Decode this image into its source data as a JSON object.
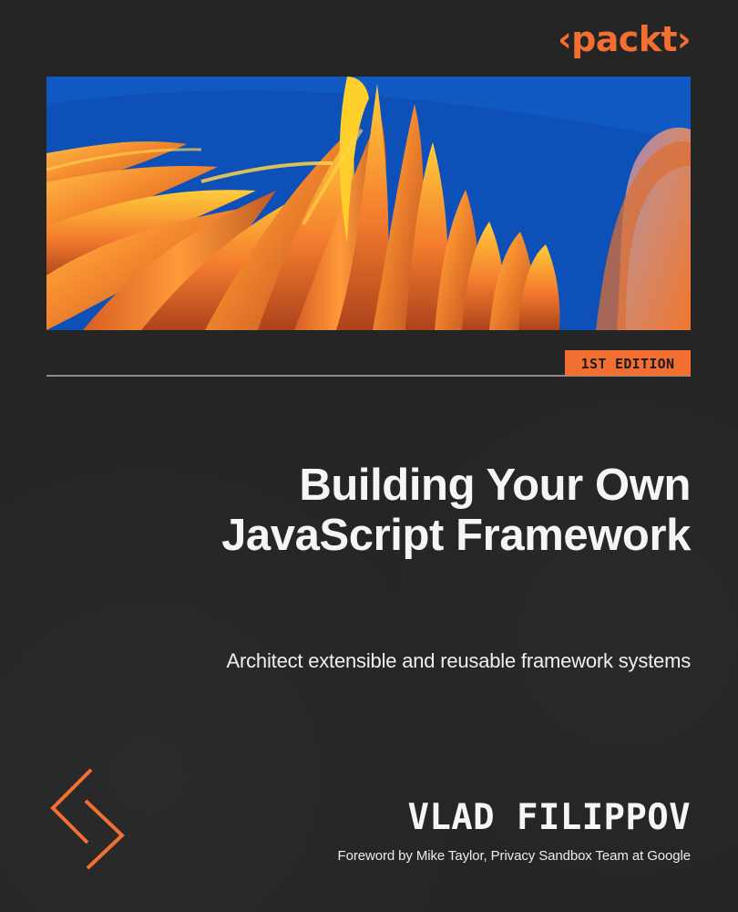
{
  "brand": {
    "name": "‹packt›",
    "accent": "#f36f31"
  },
  "cover": {
    "edition": "1ST EDITION",
    "title_line_1": "Building Your Own",
    "title_line_2": "JavaScript Framework",
    "subtitle": "Architect extensible and reusable framework systems",
    "author": "VLAD FILIPPOV",
    "foreword": "Foreword by Mike Taylor, Privacy Sandbox Team at Google"
  },
  "colors": {
    "background": "#252525",
    "art_sky": "#0c4eb6",
    "art_orange": "#f36f31",
    "art_yellow": "#f7c12c",
    "text": "#f5f5f5"
  },
  "icons": {
    "brand": "packt-logo",
    "decorative_mark": "chevron-mark-icon"
  }
}
